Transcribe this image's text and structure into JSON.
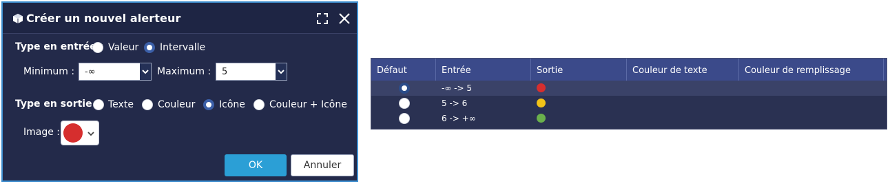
{
  "dialog": {
    "title": "Créer un nouvel alerteur",
    "input_type": {
      "label": "Type en entrée :",
      "options": [
        {
          "label": "Valeur",
          "checked": false
        },
        {
          "label": "Intervalle",
          "checked": true
        }
      ]
    },
    "minimum": {
      "label": "Minimum :",
      "value": "-∞"
    },
    "maximum": {
      "label": "Maximum :",
      "value": "5"
    },
    "output_type": {
      "label": "Type en sortie :",
      "options": [
        {
          "label": "Texte",
          "checked": false
        },
        {
          "label": "Couleur",
          "checked": false
        },
        {
          "label": "Icône",
          "checked": true
        },
        {
          "label": "Couleur + Icône",
          "checked": false
        }
      ]
    },
    "image": {
      "label": "Image :",
      "color": "#d62e2e",
      "icon": "red-circle-icon"
    },
    "buttons": {
      "ok": "OK",
      "cancel": "Annuler"
    },
    "colors": {
      "accent": "#2b9fd6",
      "background": "#232a4a",
      "border": "#3f8fd0"
    }
  },
  "table": {
    "columns": [
      "Défaut",
      "Entrée",
      "Sortie",
      "Couleur de texte",
      "Couleur de remplissage"
    ],
    "rows": [
      {
        "default": true,
        "entry": "-∞ -> 5",
        "output_color": "#d62e2e"
      },
      {
        "default": false,
        "entry": "5 -> 6",
        "output_color": "#f2c318"
      },
      {
        "default": false,
        "entry": "6 -> +∞",
        "output_color": "#6ab04c"
      }
    ]
  }
}
